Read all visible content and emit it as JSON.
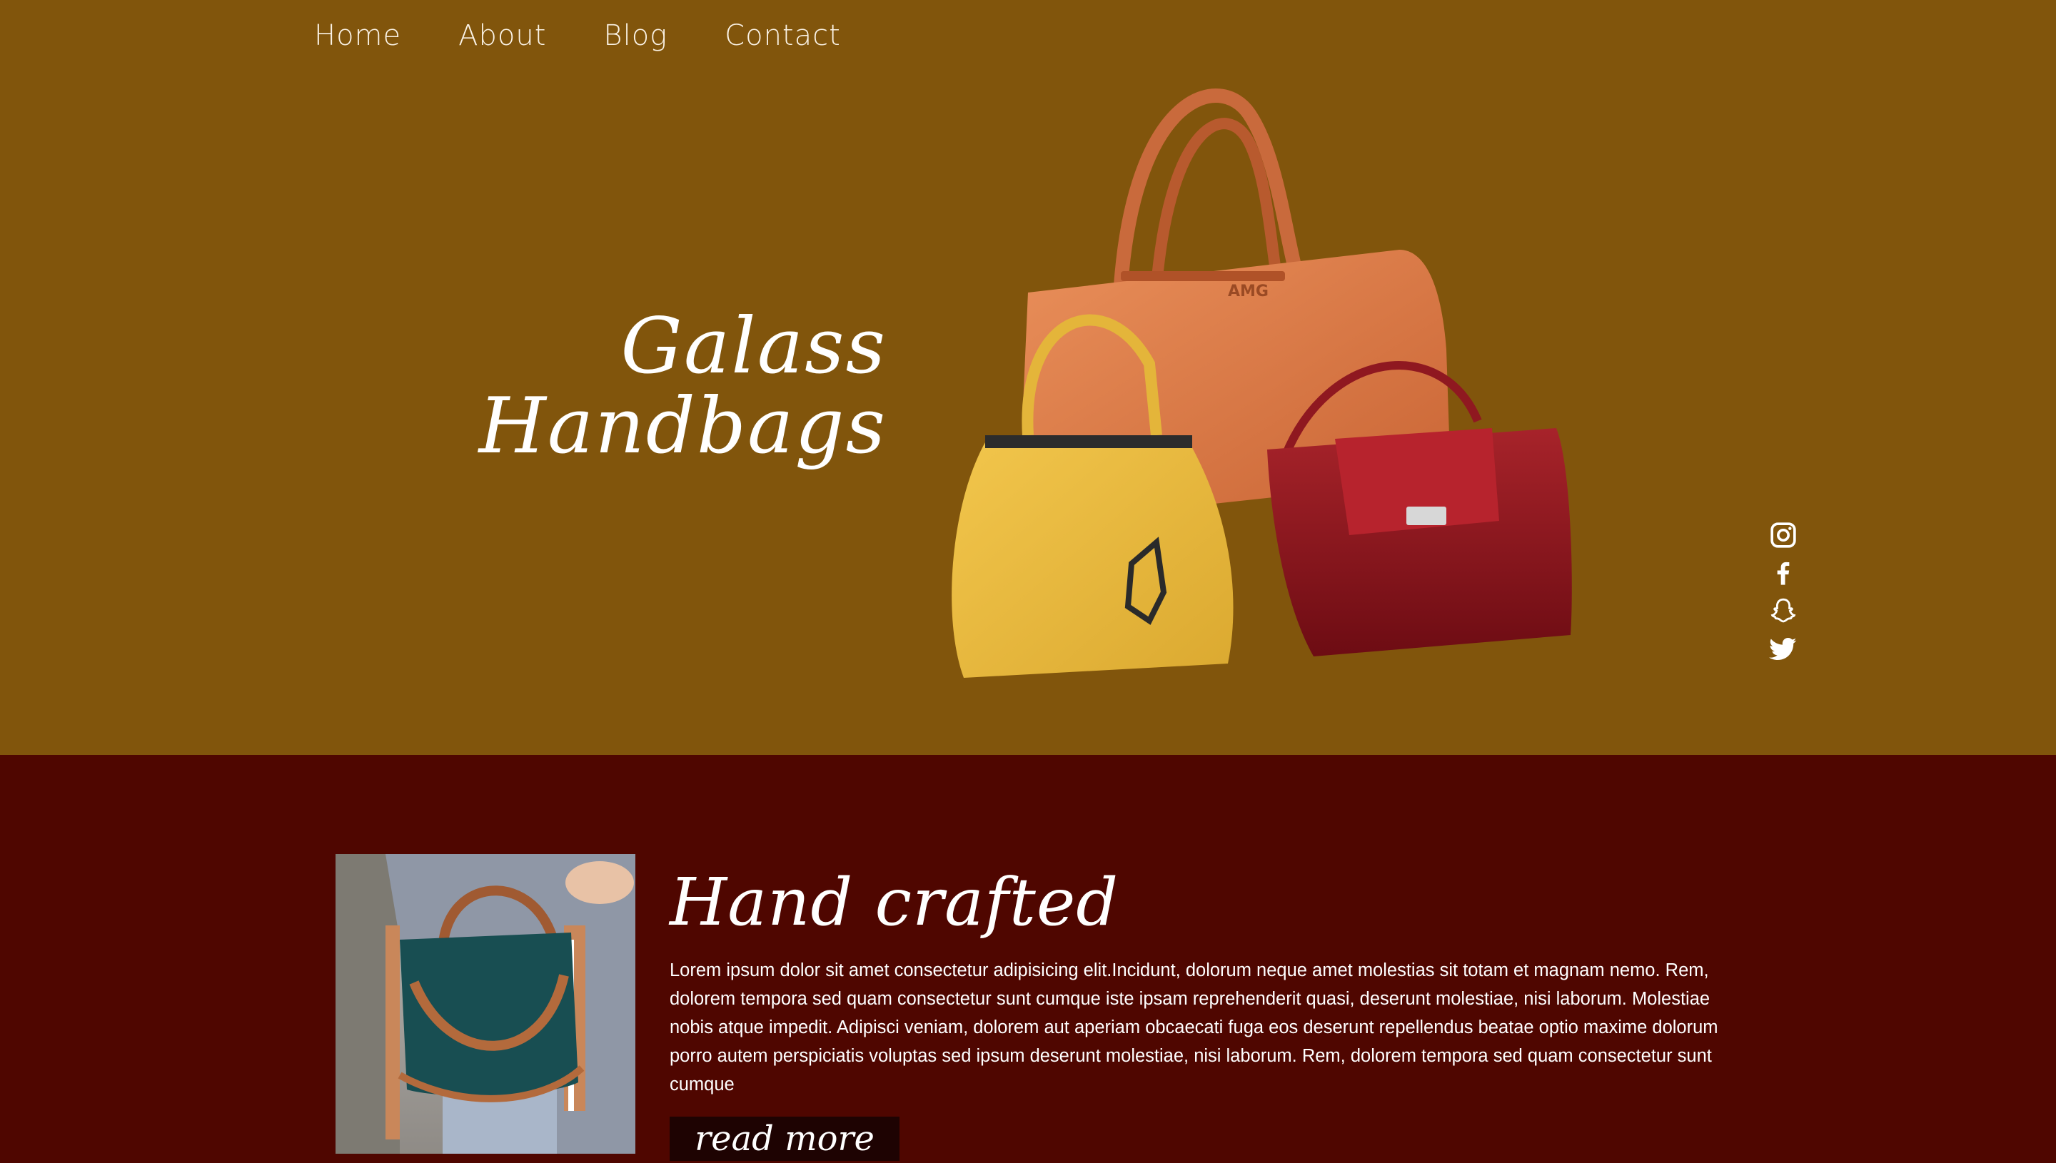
{
  "nav": {
    "items": [
      "Home",
      "About",
      "Blog",
      "Contact"
    ]
  },
  "hero": {
    "title_line1": "Galass",
    "title_line2": "Handbags",
    "bag_brand": "AMG",
    "background_color": "#81550c"
  },
  "social": {
    "icons": [
      "instagram-icon",
      "facebook-icon",
      "snapchat-icon",
      "twitter-icon"
    ]
  },
  "feature": {
    "title": "Hand crafted",
    "text": "Lorem ipsum dolor sit amet consectetur adipisicing elit.Incidunt, dolorum neque amet molestias sit totam et magnam nemo. Rem, dolorem tempora sed quam consectetur sunt cumque iste ipsam reprehenderit quasi, deserunt molestiae, nisi laborum. Molestiae nobis atque impedit. Adipisci veniam, dolorem aut aperiam obcaecati fuga eos deserunt repellendus beatae optio maxime dolorum porro autem perspiciatis voluptas sed ipsum deserunt molestiae, nisi laborum. Rem, dolorem tempora sed quam consectetur sunt cumque",
    "read_more": "read more",
    "background_color": "#4f0600"
  }
}
